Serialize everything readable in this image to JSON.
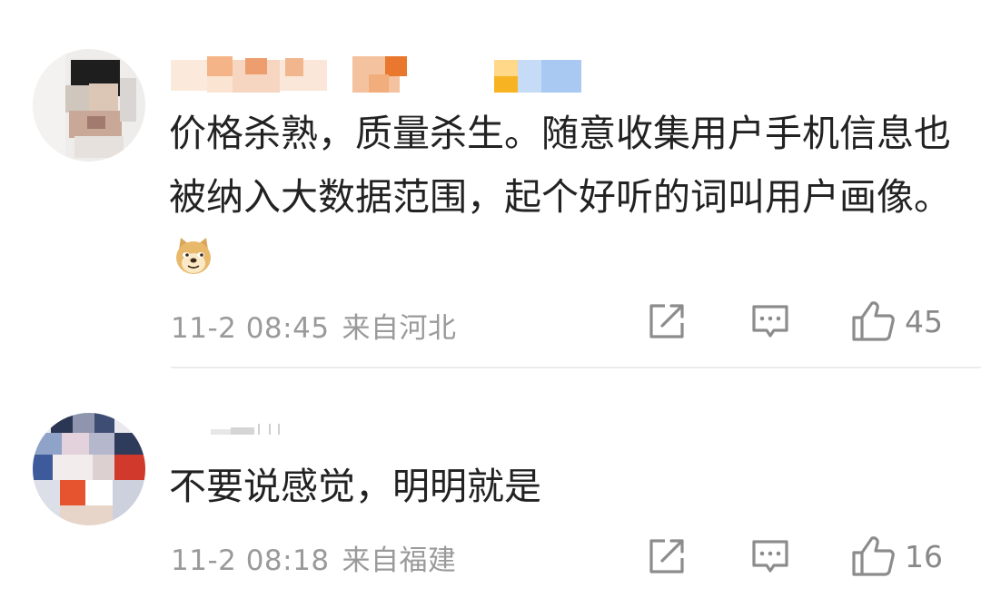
{
  "comments": [
    {
      "text": "价格杀熟，质量杀生。随意收集用户手机信息也被纳入大数据范围，起个好听的词叫用户画像。",
      "emoji_icon": "doge-emoji",
      "time": "11-2 08:45",
      "location": "来自河北",
      "likes": "45"
    },
    {
      "text": "不要说感觉，明明就是",
      "time": "11-2 08:18",
      "location": "来自福建",
      "likes": "16"
    }
  ],
  "icons": {
    "share": "share-icon",
    "reply": "comment-icon",
    "like": "thumbs-up-icon"
  },
  "colors": {
    "text": "#222222",
    "meta": "#9a9a9a",
    "icon": "#8c8c8c"
  }
}
